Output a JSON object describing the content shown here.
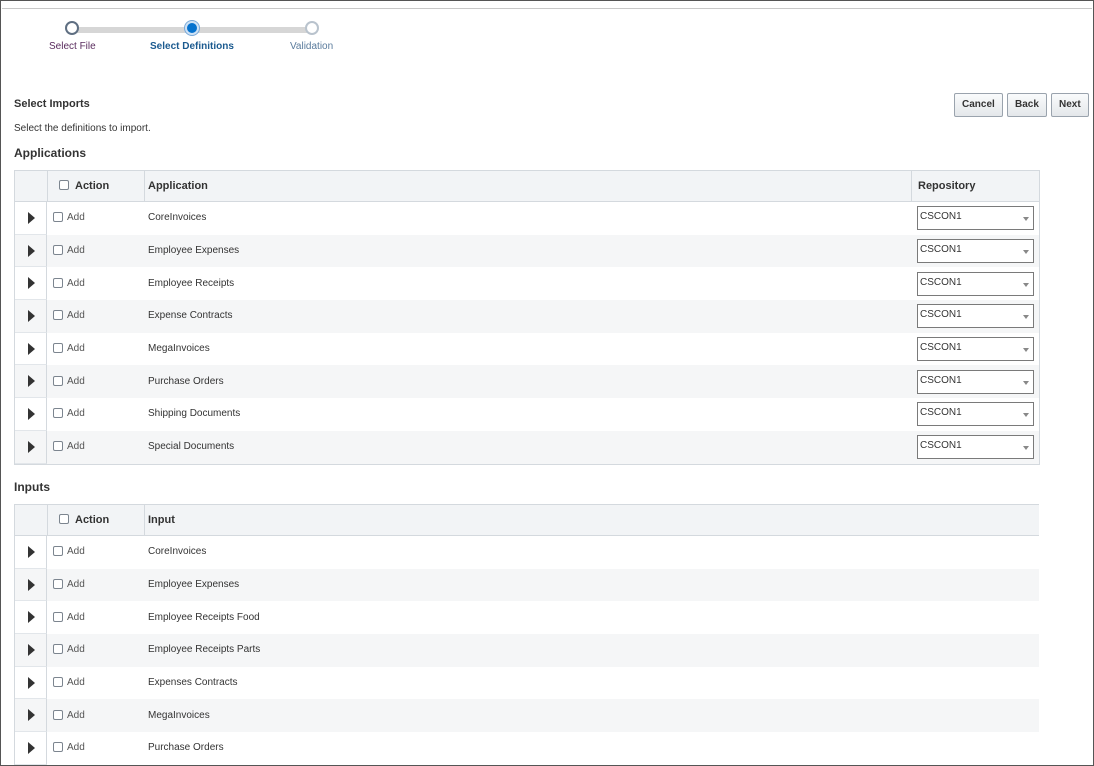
{
  "train": {
    "steps": [
      {
        "label": "Select File",
        "state": "done",
        "color": "#5a2c5e"
      },
      {
        "label": "Select Definitions",
        "state": "current",
        "color": "#1b5a8f"
      },
      {
        "label": "Validation",
        "state": "todo",
        "color": "#5a7b9c"
      }
    ]
  },
  "page": {
    "title": "Select Imports",
    "description": "Select the definitions to import."
  },
  "buttons": {
    "cancel": "Cancel",
    "back": "Back",
    "next": "Next"
  },
  "applications": {
    "heading": "Applications",
    "columns": {
      "action": "Action",
      "name": "Application",
      "repository": "Repository"
    },
    "add_label": "Add",
    "rows": [
      {
        "name": "CoreInvoices",
        "repository": "CSCON1"
      },
      {
        "name": "Employee Expenses",
        "repository": "CSCON1"
      },
      {
        "name": "Employee Receipts",
        "repository": "CSCON1"
      },
      {
        "name": "Expense Contracts",
        "repository": "CSCON1"
      },
      {
        "name": "MegaInvoices",
        "repository": "CSCON1"
      },
      {
        "name": "Purchase Orders",
        "repository": "CSCON1"
      },
      {
        "name": "Shipping Documents",
        "repository": "CSCON1"
      },
      {
        "name": "Special Documents",
        "repository": "CSCON1"
      }
    ]
  },
  "inputs": {
    "heading": "Inputs",
    "columns": {
      "action": "Action",
      "name": "Input"
    },
    "add_label": "Add",
    "rows": [
      {
        "name": "CoreInvoices"
      },
      {
        "name": "Employee Expenses"
      },
      {
        "name": "Employee Receipts Food"
      },
      {
        "name": "Employee Receipts Parts"
      },
      {
        "name": "Expenses Contracts"
      },
      {
        "name": "MegaInvoices"
      },
      {
        "name": "Purchase Orders"
      }
    ]
  }
}
